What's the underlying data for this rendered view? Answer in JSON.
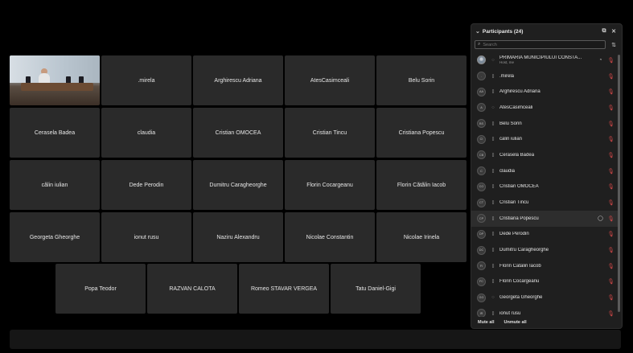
{
  "tiles": {
    "video_tile_name": "",
    "row1": [
      ".mirela",
      "Arghirescu Adriana",
      "AtesCasimceali",
      "Belu Sorin"
    ],
    "row2": [
      "Cerasela Badea",
      "claudia",
      "Cristian OMOCEA",
      "Cristian Tincu",
      "Cristiana Popescu"
    ],
    "row3": [
      "călin iulian",
      "Dede Perodin",
      "Dumitru Caragheorghe",
      "Florin Cocargeanu",
      "Florin Cătălin Iacob"
    ],
    "row4": [
      "Georgeta Gheorghe",
      "ionut rusu",
      "Naziru Alexandru",
      "Nicolae Constantin",
      "Nicolae Irinela"
    ],
    "row5": [
      "Popa Teodor",
      "RAZVAN CALOTA",
      "Romeo STAVAR VERGEA",
      "Tatu Daniel-Gigi"
    ]
  },
  "panel": {
    "title": "Participants (24)",
    "search_placeholder": "Search",
    "mute_all": "Mute all",
    "unmute_all": "Unmute all",
    "participants": [
      {
        "name": "PRIMARIA MUNICIPIULUI CONSTA...",
        "sub": "Host, me",
        "initials": "",
        "photo": true
      },
      {
        "name": ".mirela",
        "initials": "."
      },
      {
        "name": "Arghirescu Adriana",
        "initials": "AA"
      },
      {
        "name": "AtesCasimceali",
        "initials": "A"
      },
      {
        "name": "Belu Sorin",
        "initials": "BS"
      },
      {
        "name": "călin iulian",
        "initials": "CI"
      },
      {
        "name": "Cerasela Badea",
        "initials": "CB"
      },
      {
        "name": "claudia",
        "initials": "C"
      },
      {
        "name": "Cristian OMOCEA",
        "initials": "CO"
      },
      {
        "name": "Cristian Tincu",
        "initials": "CT"
      },
      {
        "name": "Cristiana Popescu",
        "initials": "CP"
      },
      {
        "name": "Dede Perodin",
        "initials": "DP"
      },
      {
        "name": "Dumitru Caragheorghe",
        "initials": "DC"
      },
      {
        "name": "Florin Cătălin Iacob",
        "initials": "FI"
      },
      {
        "name": "Florin Cocargeanu",
        "initials": "FC"
      },
      {
        "name": "Georgeta Gheorghe",
        "initials": "GG"
      },
      {
        "name": "ionut rusu",
        "initials": "IR"
      }
    ]
  }
}
